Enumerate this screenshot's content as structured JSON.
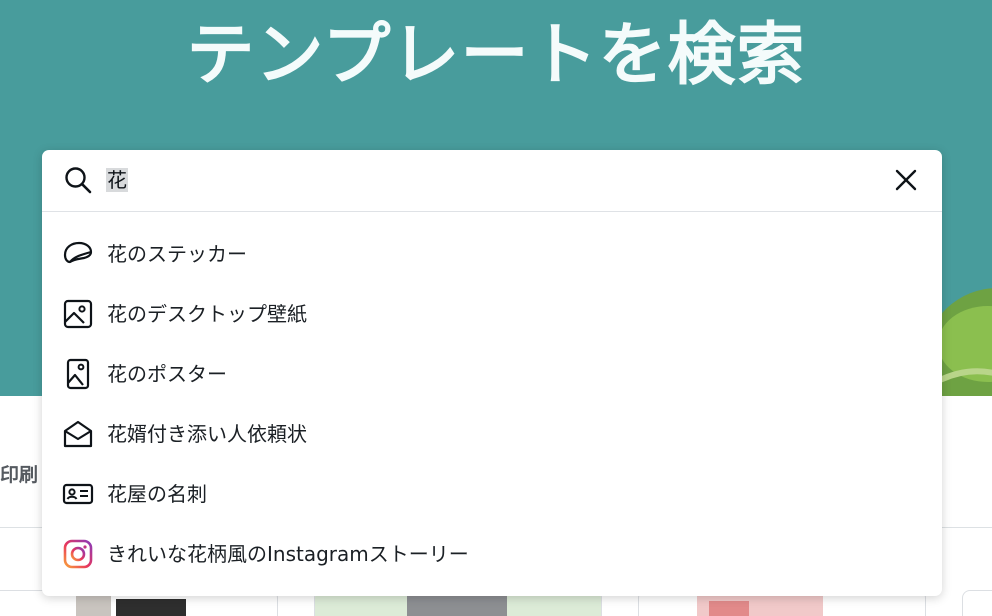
{
  "hero": {
    "title": "テンプレートを検索",
    "background_color": "#489c9c"
  },
  "side_label": "印刷",
  "search": {
    "query": "花",
    "clear_icon": "close-icon",
    "search_icon": "search-icon"
  },
  "suggestions": [
    {
      "label": "花のステッカー",
      "icon": "sticker-icon"
    },
    {
      "label": "花のデスクトップ壁紙",
      "icon": "image-icon"
    },
    {
      "label": "花のポスター",
      "icon": "poster-icon"
    },
    {
      "label": "花婿付き添い人依頼状",
      "icon": "envelope-icon"
    },
    {
      "label": "花屋の名刺",
      "icon": "business-card-icon"
    },
    {
      "label": "きれいな花柄風のInstagramストーリー",
      "icon": "instagram-icon"
    }
  ]
}
